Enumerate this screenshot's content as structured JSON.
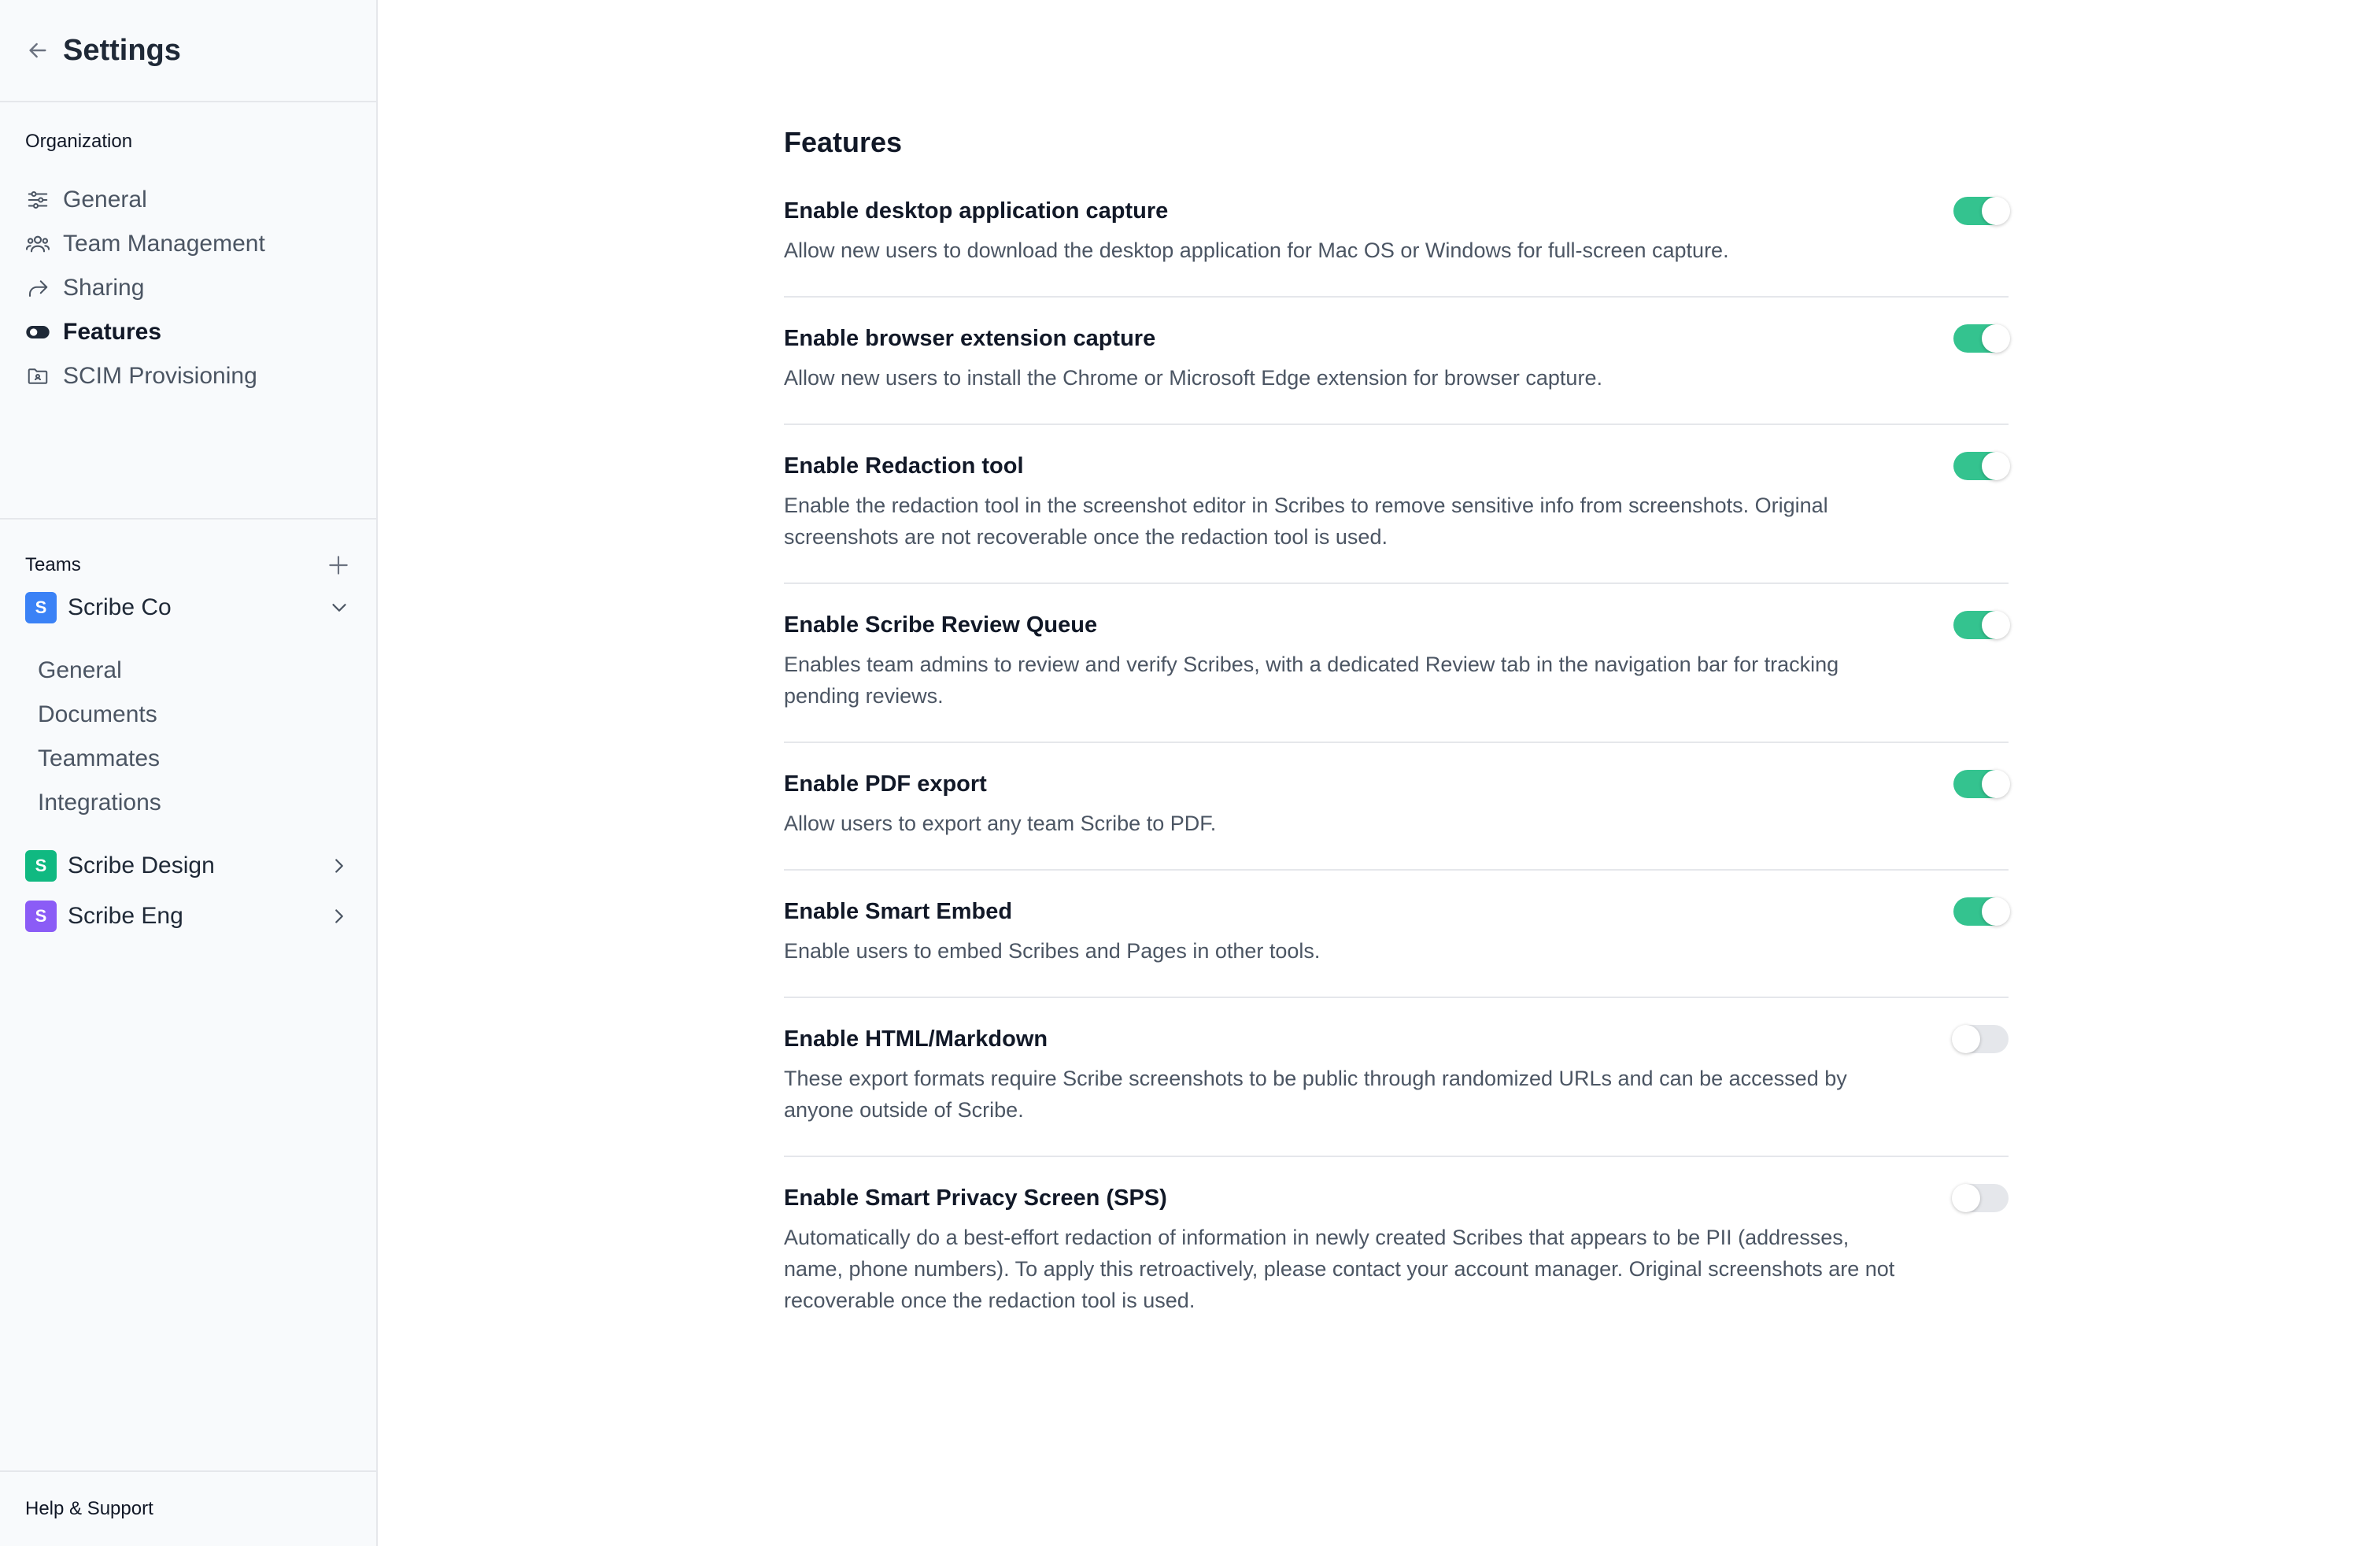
{
  "sidebar": {
    "title": "Settings",
    "organization": {
      "label": "Organization",
      "items": [
        {
          "label": "General",
          "icon": "sliders-icon"
        },
        {
          "label": "Team Management",
          "icon": "users-icon"
        },
        {
          "label": "Sharing",
          "icon": "share-arrow-icon"
        },
        {
          "label": "Features",
          "icon": "toggle-icon",
          "active": true
        },
        {
          "label": "SCIM Provisioning",
          "icon": "folder-user-icon"
        }
      ]
    },
    "teams": {
      "label": "Teams",
      "list": [
        {
          "badge": "S",
          "name": "Scribe Co",
          "color": "#3b82f6",
          "expanded": true,
          "subitems": [
            "General",
            "Documents",
            "Teammates",
            "Integrations"
          ]
        },
        {
          "badge": "S",
          "name": "Scribe Design",
          "color": "#10b981",
          "expanded": false
        },
        {
          "badge": "S",
          "name": "Scribe Eng",
          "color": "#8b5cf6",
          "expanded": false
        }
      ]
    },
    "footer": "Help & Support"
  },
  "main": {
    "title": "Features",
    "features": [
      {
        "title": "Enable desktop application capture",
        "desc": "Allow new users to download the desktop application for Mac OS or Windows for full-screen capture.",
        "enabled": true
      },
      {
        "title": "Enable browser extension capture",
        "desc": "Allow new users to install the Chrome or Microsoft Edge extension for browser capture.",
        "enabled": true
      },
      {
        "title": "Enable Redaction tool",
        "desc": "Enable the redaction tool in the screenshot editor in Scribes to remove sensitive info from screenshots. Original screenshots are not recoverable once the redaction tool is used.",
        "enabled": true
      },
      {
        "title": "Enable Scribe Review Queue",
        "desc": "Enables team admins to review and verify Scribes, with a dedicated Review tab in the navigation bar for tracking pending reviews.",
        "enabled": true
      },
      {
        "title": "Enable PDF export",
        "desc": "Allow users to export any team Scribe to PDF.",
        "enabled": true
      },
      {
        "title": "Enable Smart Embed",
        "desc": "Enable users to embed Scribes and Pages in other tools.",
        "enabled": true
      },
      {
        "title": "Enable HTML/Markdown",
        "desc": "These export formats require Scribe screenshots to be public through randomized URLs and can be accessed by anyone outside of Scribe.",
        "enabled": false
      },
      {
        "title": "Enable Smart Privacy Screen (SPS)",
        "desc": "Automatically do a best-effort redaction of information in newly created Scribes that appears to be PII (addresses, name, phone numbers). To apply this retroactively, please contact your account manager. Original screenshots are not recoverable once the redaction tool is used.",
        "enabled": false
      }
    ]
  },
  "colors": {
    "toggle_on": "#34c38f",
    "toggle_off": "#e5e7eb"
  }
}
